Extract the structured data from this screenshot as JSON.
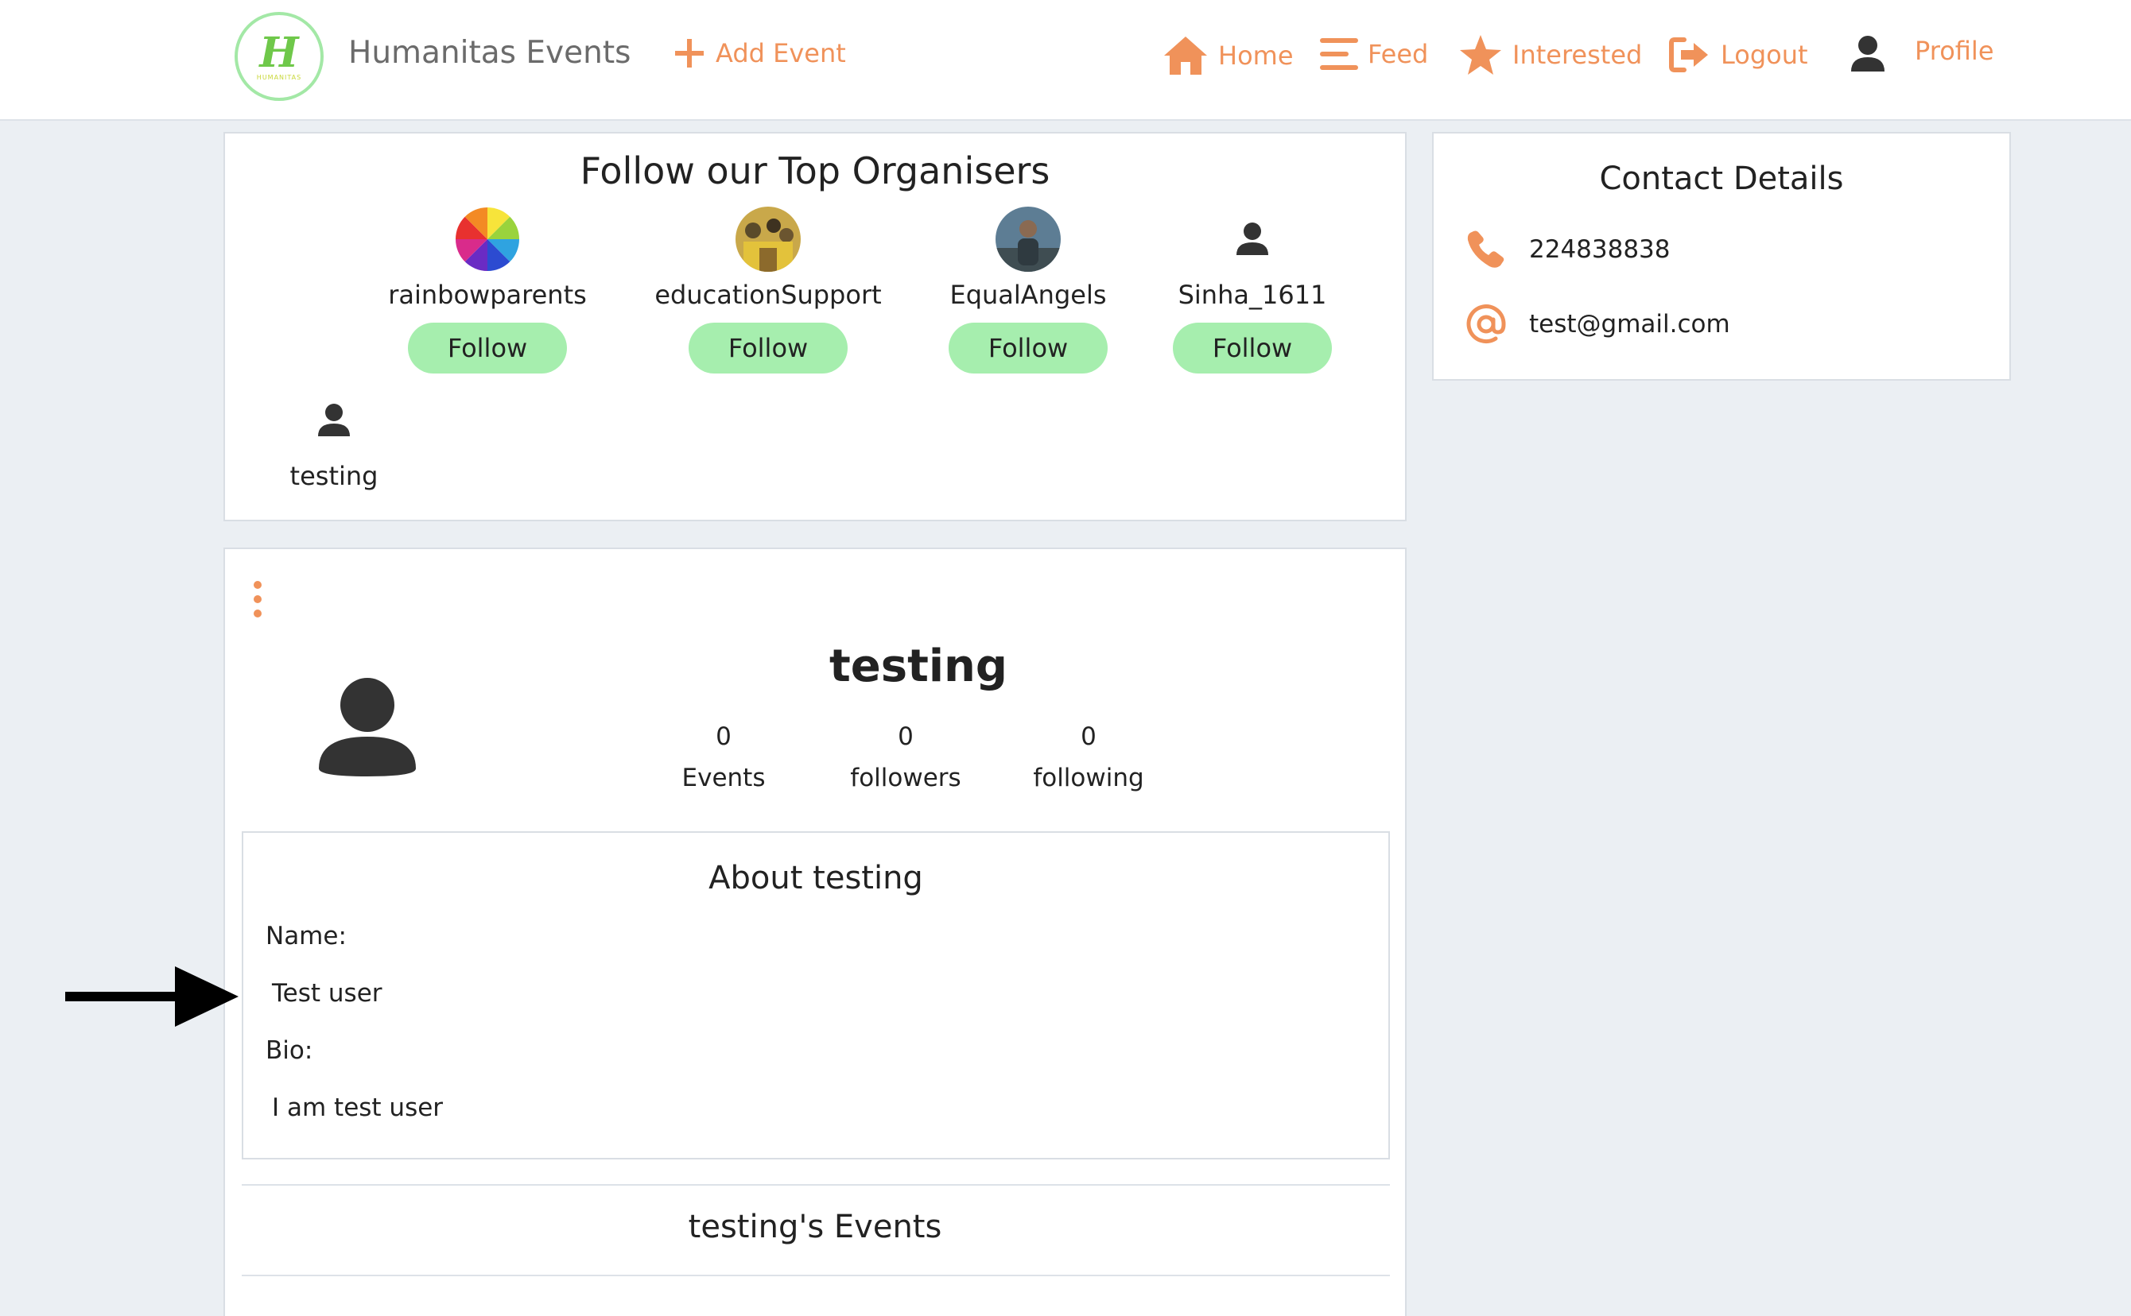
{
  "navbar": {
    "brand": "Humanitas Events",
    "logo_letter": "H",
    "logo_caption": "HUMANITAS",
    "add_event": "Add Event",
    "home": "Home",
    "feed": "Feed",
    "interested": "Interested",
    "logout": "Logout",
    "profile": "Profile"
  },
  "organisers": {
    "title": "Follow our Top Organisers",
    "follow_label": "Follow",
    "items": [
      {
        "name": "rainbowparents",
        "avatar": "rainbow-wheel"
      },
      {
        "name": "educationSupport",
        "avatar": "photo"
      },
      {
        "name": "EqualAngels",
        "avatar": "photo"
      },
      {
        "name": "Sinha_1611",
        "avatar": "user-icon"
      },
      {
        "name": "testing",
        "avatar": "user-icon"
      }
    ]
  },
  "contact": {
    "title": "Contact Details",
    "phone": "224838838",
    "email": "test@gmail.com"
  },
  "profile": {
    "username": "testing",
    "stats": [
      {
        "value": "0",
        "label": "Events"
      },
      {
        "value": "0",
        "label": "followers"
      },
      {
        "value": "0",
        "label": "following"
      }
    ],
    "about": {
      "title": "About testing",
      "name_label": "Name:",
      "name_value": "Test user",
      "bio_label": "Bio:",
      "bio_value": "I am test user"
    },
    "events_title": "testing's Events"
  },
  "colors": {
    "accent": "#f0925a",
    "follow_button": "#a6eeae",
    "background": "#ebeff3"
  }
}
